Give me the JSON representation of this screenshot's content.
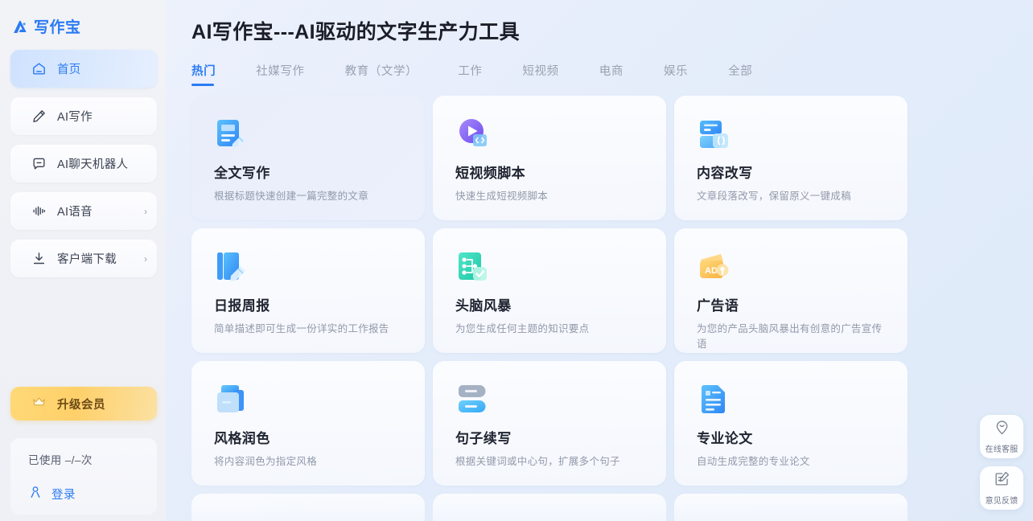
{
  "brand": {
    "name": "写作宝",
    "logo_icon": "logo-triangle-icon",
    "color": "#2b7bf3"
  },
  "sidebar": {
    "items": [
      {
        "label": "首页",
        "icon": "home-icon",
        "active": true,
        "chevron": ""
      },
      {
        "label": "AI写作",
        "icon": "pencil-icon",
        "active": false,
        "chevron": ""
      },
      {
        "label": "AI聊天机器人",
        "icon": "chat-minus-icon",
        "active": false,
        "chevron": ""
      },
      {
        "label": "AI语音",
        "icon": "waveform-icon",
        "active": false,
        "chevron": "›"
      },
      {
        "label": "客户端下载",
        "icon": "download-icon",
        "active": false,
        "chevron": "›"
      }
    ],
    "vip": {
      "label": "升级会员",
      "icon": "crown-icon",
      "color": "#ffd06a"
    },
    "account": {
      "usage_label": "已使用 –/–次",
      "login_label": "登录",
      "login_icon": "user-icon"
    }
  },
  "header": {
    "title": "AI写作宝---AI驱动的文字生产力工具"
  },
  "tabs": [
    {
      "label": "热门",
      "active": true
    },
    {
      "label": "社媒写作",
      "active": false
    },
    {
      "label": "教育（文学）",
      "active": false
    },
    {
      "label": "工作",
      "active": false
    },
    {
      "label": "短视频",
      "active": false
    },
    {
      "label": "电商",
      "active": false
    },
    {
      "label": "娱乐",
      "active": false
    },
    {
      "label": "全部",
      "active": false
    }
  ],
  "cards": [
    {
      "title": "全文写作",
      "desc": "根据标题快速创建一篇完整的文章",
      "icon": "document-pencil-icon",
      "hover": true
    },
    {
      "title": "短视频脚本",
      "desc": "快速生成短视频脚本",
      "icon": "play-code-icon",
      "hover": false
    },
    {
      "title": "内容改写",
      "desc": "文章段落改写，保留原义一键成稿",
      "icon": "rewrite-cards-icon",
      "hover": false
    },
    {
      "title": "日报周报",
      "desc": "简单描述即可生成一份详实的工作报告",
      "icon": "notebook-pencil-icon",
      "hover": false
    },
    {
      "title": "头脑风暴",
      "desc": "为您生成任何主题的知识要点",
      "icon": "mindmap-check-icon",
      "hover": false
    },
    {
      "title": "广告语",
      "desc": "为您的产品头脑风暴出有创意的广告宣传语",
      "icon": "ad-wallet-icon",
      "hover": false
    },
    {
      "title": "风格润色",
      "desc": "将内容润色为指定风格",
      "icon": "layers-folder-icon",
      "hover": false
    },
    {
      "title": "句子续写",
      "desc": "根据关键词或中心句，扩展多个句子",
      "icon": "two-bars-icon",
      "hover": false
    },
    {
      "title": "专业论文",
      "desc": "自动生成完整的专业论文",
      "icon": "paper-document-icon",
      "hover": false
    }
  ],
  "floaters": [
    {
      "label": "在线客服",
      "icon": "support-smiley-pin-icon"
    },
    {
      "label": "意见反馈",
      "icon": "feedback-note-pencil-icon"
    }
  ]
}
